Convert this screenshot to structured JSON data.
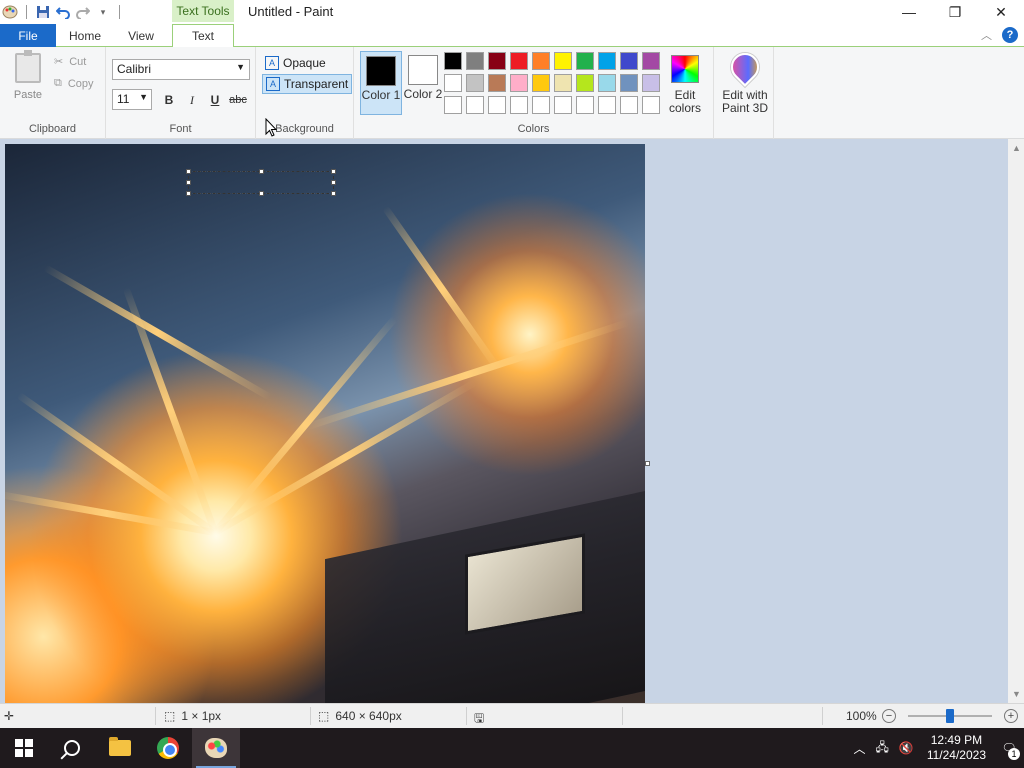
{
  "window": {
    "title": "Untitled - Paint",
    "context_tab": "Text Tools",
    "controls": {
      "minimize": "—",
      "maximize": "❐",
      "close": "✕"
    }
  },
  "tabs": {
    "file": "File",
    "home": "Home",
    "view": "View",
    "text": "Text"
  },
  "ribbon": {
    "clipboard": {
      "paste": "Paste",
      "cut": "Cut",
      "copy": "Copy",
      "label": "Clipboard"
    },
    "font": {
      "family": "Calibri",
      "size": "11",
      "bold": "B",
      "italic": "I",
      "underline": "U",
      "strike": "abc",
      "label": "Font"
    },
    "background": {
      "opaque": "Opaque",
      "transparent": "Transparent",
      "label": "Background"
    },
    "colors": {
      "color1": "Color 1",
      "color2": "Color 2",
      "edit_colors": "Edit colors",
      "label": "Colors",
      "color1_value": "#000000",
      "color2_value": "#ffffff",
      "palette": [
        "#000000",
        "#7f7f7f",
        "#880015",
        "#ed1c24",
        "#ff7f27",
        "#fff200",
        "#22b14c",
        "#00a2e8",
        "#3f48cc",
        "#a349a4",
        "#ffffff",
        "#c3c3c3",
        "#b97a57",
        "#ffaec9",
        "#ffc90e",
        "#efe4b0",
        "#b5e61d",
        "#99d9ea",
        "#7092be",
        "#c8bfe7",
        "#ffffff",
        "#ffffff",
        "#ffffff",
        "#ffffff",
        "#ffffff",
        "#ffffff",
        "#ffffff",
        "#ffffff",
        "#ffffff",
        "#ffffff"
      ]
    },
    "paint3d": {
      "label": "Edit with Paint 3D"
    }
  },
  "status": {
    "selection_size": "1 × 1px",
    "image_size": "640 × 640px",
    "zoom": "100%"
  },
  "taskbar": {
    "apps": [
      "start",
      "search",
      "file-explorer",
      "chrome",
      "paint"
    ],
    "time": "12:49 PM",
    "date": "11/24/2023",
    "notifications": "1"
  }
}
